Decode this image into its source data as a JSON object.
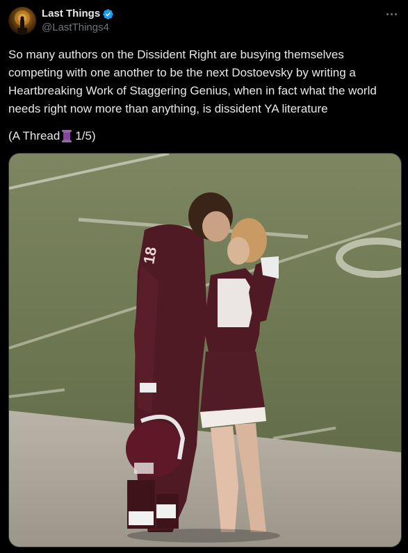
{
  "author": {
    "display_name": "Last Things",
    "handle": "@LastThings4",
    "verified": true,
    "avatar_icon": "avatar-figure-icon"
  },
  "tweet": {
    "text": "So many authors on the Dissident Right are busying themselves competing with one another to be the next Dostoevsky by writing a Heartbreaking Work of Staggering Genius, when in fact what the world needs right now more than anything, is dissident YA literature",
    "thread_prefix": "(A Thread",
    "thread_emoji": "spool-of-thread-icon",
    "thread_counter": "1/5)"
  },
  "media": {
    "description_icon": "photo-football-field-icon",
    "jersey_number": "18"
  },
  "colors": {
    "background": "#000000",
    "text_primary": "#e7e9ea",
    "text_secondary": "#71767b",
    "verified_blue": "#1d9bf0",
    "maroon": "#5a1e2a",
    "field_green": "#6f7a52"
  }
}
